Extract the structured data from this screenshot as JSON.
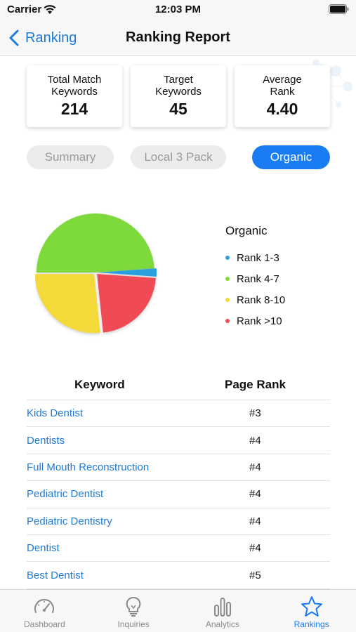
{
  "status_bar": {
    "carrier": "Carrier",
    "time": "12:03 PM"
  },
  "nav": {
    "back_label": "Ranking",
    "title": "Ranking Report"
  },
  "stats": [
    {
      "label_line1": "Total Match",
      "label_line2": "Keywords",
      "value": "214"
    },
    {
      "label_line1": "Target",
      "label_line2": "Keywords",
      "value": "45"
    },
    {
      "label_line1": "Average",
      "label_line2": "Rank",
      "value": "4.40"
    }
  ],
  "tabs": [
    {
      "label": "Summary",
      "active": false
    },
    {
      "label": "Local 3 Pack",
      "active": false
    },
    {
      "label": "Organic",
      "active": true
    }
  ],
  "chart_data": {
    "type": "pie",
    "title": "Organic",
    "slices": [
      {
        "label": "Rank 1-3",
        "value": 1,
        "color": "#2a9fe0"
      },
      {
        "label": "Rank 4-7",
        "value": 22,
        "color": "#7ed93a"
      },
      {
        "label": "Rank 8-10",
        "value": 12,
        "color": "#f4d93a"
      },
      {
        "label": "Rank >10",
        "value": 10,
        "color": "#f04b55"
      }
    ],
    "legend_position": "right"
  },
  "table": {
    "headers": {
      "keyword": "Keyword",
      "page_rank": "Page Rank"
    },
    "rows": [
      {
        "keyword": "Kids Dentist",
        "rank": "#3"
      },
      {
        "keyword": "Dentists",
        "rank": "#4"
      },
      {
        "keyword": "Full Mouth Reconstruction",
        "rank": "#4"
      },
      {
        "keyword": "Pediatric Dentist",
        "rank": "#4"
      },
      {
        "keyword": "Pediatric Dentistry",
        "rank": "#4"
      },
      {
        "keyword": "Dentist",
        "rank": "#4"
      },
      {
        "keyword": "Best Dentist",
        "rank": "#5"
      }
    ]
  },
  "tab_bar": [
    {
      "label": "Dashboard",
      "icon": "speedometer-icon",
      "selected": false
    },
    {
      "label": "Inquiries",
      "icon": "lightbulb-icon",
      "selected": false
    },
    {
      "label": "Analytics",
      "icon": "bar-chart-icon",
      "selected": false
    },
    {
      "label": "Rankings",
      "icon": "star-icon",
      "selected": true
    }
  ],
  "colors": {
    "accent": "#1a7cf2",
    "link": "#1e7bd8",
    "inactive_tab": "#ececec"
  }
}
